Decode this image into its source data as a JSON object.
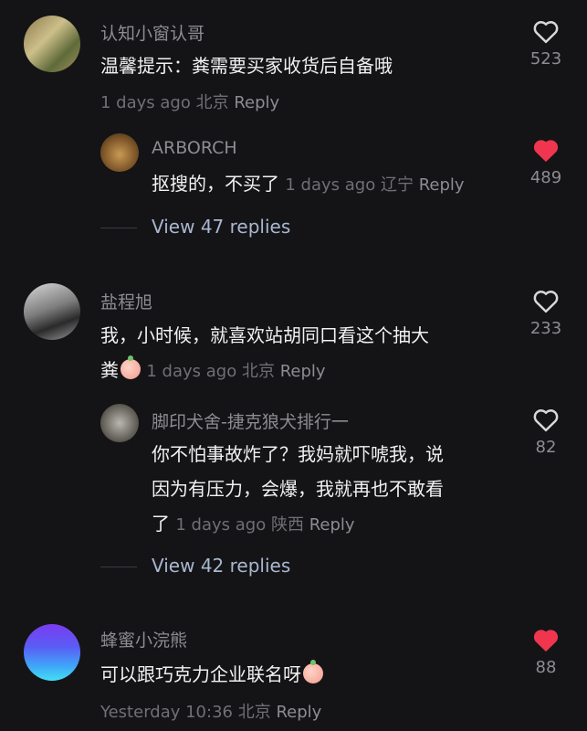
{
  "comments": [
    {
      "username": "认知小窗认哥",
      "text": "温馨提示：粪需要买家收货后自备哦",
      "time": "1 days ago",
      "location": "北京",
      "reply_label": "Reply",
      "likes": "523",
      "liked": false,
      "reply": {
        "username": "ARBORCH",
        "text": "抠搜的，不买了",
        "time": "1 days ago",
        "location": "辽宁",
        "reply_label": "Reply",
        "likes": "489",
        "liked": true
      },
      "view_replies": "View 47 replies"
    },
    {
      "username": "盐程旭",
      "text_line1": "我，小时候，就喜欢站胡同口看这个抽大",
      "text_line2": "粪",
      "time": "1 days ago",
      "location": "北京",
      "reply_label": "Reply",
      "likes": "233",
      "liked": false,
      "reply": {
        "username": "脚印犬舍-捷克狼犬排行一",
        "text_line1": "你不怕事故炸了？我妈就吓唬我，说",
        "text_line2": "因为有压力，会爆，我就再也不敢看",
        "text_line3": "了",
        "time": "1 days ago",
        "location": "陕西",
        "reply_label": "Reply",
        "likes": "82",
        "liked": false
      },
      "view_replies": "View 42 replies"
    },
    {
      "username": "蜂蜜小浣熊",
      "text": "可以跟巧克力企业联名呀",
      "time": "Yesterday 10:36",
      "location": "北京",
      "reply_label": "Reply",
      "likes": "88",
      "liked": true
    }
  ],
  "icons": {
    "like": "heart-icon",
    "emoji": "crying-face-emoji"
  },
  "colors": {
    "liked": "#f0364f",
    "unliked": "#d8d8da",
    "view_replies": "#a9b7cf"
  }
}
